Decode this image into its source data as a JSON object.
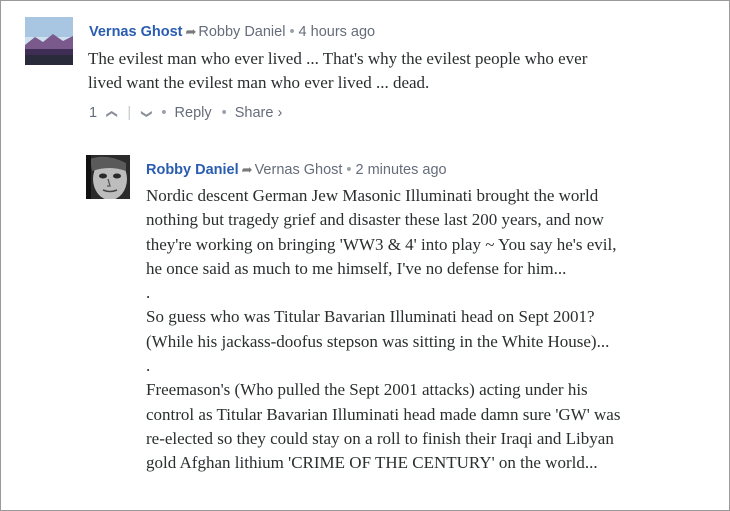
{
  "comment1": {
    "author": "Vernas Ghost",
    "reply_to": "Robby Daniel",
    "time": "4 hours ago",
    "lines": [
      "The evilest man who ever lived ... That's why the evilest people who ever",
      "lived want the evilest man who ever lived ... dead."
    ],
    "upvotes": "1",
    "reply_label": "Reply",
    "share_label": "Share ›"
  },
  "comment2": {
    "author": "Robby Daniel",
    "reply_to": "Vernas Ghost",
    "time": "2 minutes ago",
    "lines": [
      "Nordic descent German Jew Masonic Illuminati brought the world",
      "nothing but tragedy grief and disaster these last 200 years, and now",
      "they're working on bringing 'WW3 & 4' into play ~ You say he's evil,",
      "he once said as much to me himself, I've no defense for him...",
      ".",
      "So guess who was Titular Bavarian Illuminati head on Sept 2001?",
      "(While his jackass-doofus stepson was sitting in the White House)...",
      ".",
      "Freemason's (Who pulled the Sept 2001 attacks) acting under his",
      "control as Titular Bavarian Illuminati head made damn sure 'GW' was",
      "re-elected so they could stay on a roll to finish their Iraqi and Libyan",
      "gold Afghan lithium 'CRIME OF THE CENTURY' on the world..."
    ]
  },
  "icons": {
    "reply_arrow": "➦",
    "upvote": "❯",
    "downvote": "❯",
    "bullet": "•"
  },
  "colors": {
    "author": "#2a5db0",
    "meta": "#656c7a",
    "text": "#2a2e2e"
  }
}
